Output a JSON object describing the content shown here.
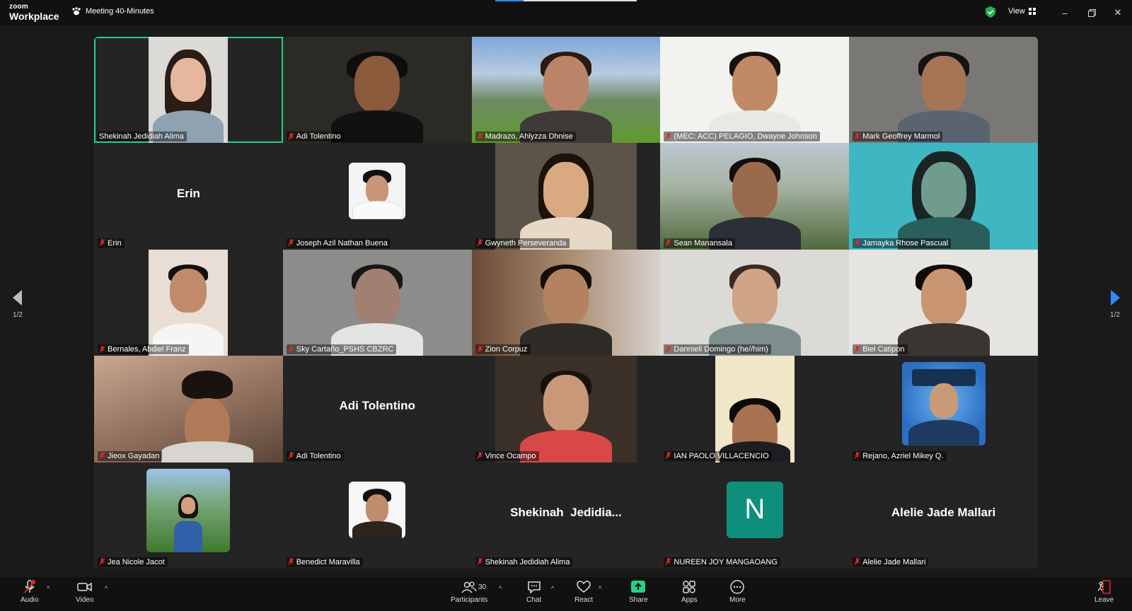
{
  "app": {
    "brand_small": "zoom",
    "brand_large": "Workplace"
  },
  "meeting": {
    "title": "Meeting 40-Minutes"
  },
  "toolbar_top": {
    "view_label": "View"
  },
  "pager": {
    "left": "1/2",
    "right": "1/2"
  },
  "tiles": [
    {
      "name": "Shekinah Jedidiah Alima",
      "muted": false
    },
    {
      "name": "Adi Tolentino",
      "muted": true
    },
    {
      "name": "Madrazo, Ahlyzza Dhnise",
      "muted": true
    },
    {
      "name": "(MEC: ACC) PELAGIO, Dwayne Johnson",
      "muted": true
    },
    {
      "name": "Mark Geoffrey Marmol",
      "muted": true
    },
    {
      "name": "Erin",
      "muted": true,
      "center_text": "Erin"
    },
    {
      "name": "Joseph Azil Nathan Buena",
      "muted": true
    },
    {
      "name": "Gwyneth Perseveranda",
      "muted": true
    },
    {
      "name": "Sean Manansala",
      "muted": true
    },
    {
      "name": "Jamayka Rhose Pascual",
      "muted": true
    },
    {
      "name": "Bernales, Abdiel Franz",
      "muted": true
    },
    {
      "name": "Sky Cartaño_PSHS CBZRC",
      "muted": true
    },
    {
      "name": "Zion Corpuz",
      "muted": true
    },
    {
      "name": "Danniell Domingo (he//him)",
      "muted": true
    },
    {
      "name": "Biel Catipon",
      "muted": true
    },
    {
      "name": "Jieox Gayadan",
      "muted": true
    },
    {
      "name": "Adi Tolentino",
      "muted": true,
      "center_text": "Adi Tolentino"
    },
    {
      "name": "Vince Ocampo",
      "muted": true
    },
    {
      "name": "IAN PAOLO VILLACENCIO",
      "muted": true
    },
    {
      "name": "Rejano, Azriel Mikey Q.",
      "muted": true
    },
    {
      "name": "Jea Nicole Jacot",
      "muted": true
    },
    {
      "name": "Benedict Maravilla",
      "muted": true
    },
    {
      "name": "Shekinah Jedidiah Alima",
      "muted": true,
      "center_text": "Shekinah  Jedidia..."
    },
    {
      "name": "NUREEN JOY MANGAOANG",
      "muted": true,
      "letter": "N"
    },
    {
      "name": "Alelie Jade Mallari",
      "muted": true,
      "center_text": "Alelie Jade Mallari"
    }
  ],
  "bottom": {
    "audio": "Audio",
    "video": "Video",
    "participants": "Participants",
    "participants_count": "30",
    "chat": "Chat",
    "react": "React",
    "share": "Share",
    "apps": "Apps",
    "more": "More",
    "leave": "Leave"
  },
  "colors": {
    "active_speaker": "#23d18b",
    "share": "#23d18b",
    "muted": "#e02828",
    "accent": "#2d8cff",
    "letter_avatar": "#0e8f7c"
  }
}
